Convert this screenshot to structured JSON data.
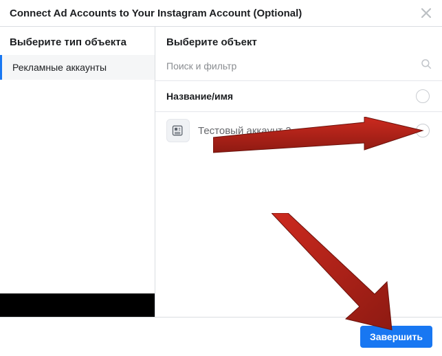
{
  "dialog": {
    "title": "Connect Ad Accounts to Your Instagram Account (Optional)"
  },
  "sidebar": {
    "header": "Выберите тип объекта",
    "items": [
      {
        "label": "Рекламные аккаунты",
        "selected": true
      }
    ]
  },
  "main": {
    "header": "Выберите объект",
    "search_placeholder": "Поиск и фильтр",
    "list_header": "Название/имя",
    "accounts": [
      {
        "name": "Тестовый аккаунт 2"
      }
    ]
  },
  "footer": {
    "primary_label": "Завершить"
  }
}
